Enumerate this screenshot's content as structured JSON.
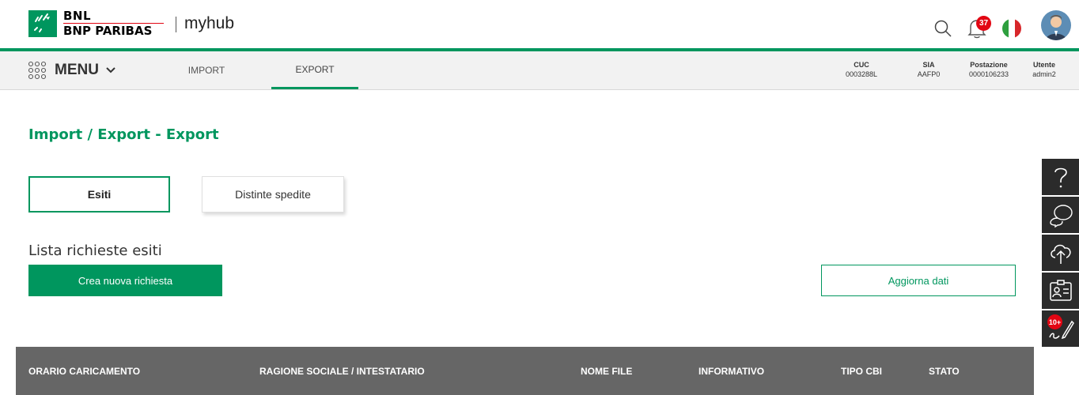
{
  "header": {
    "brand_line1": "BNL",
    "brand_line2": "BNP PARIBAS",
    "app_name": "myhub",
    "notifications_count": "37",
    "colors": {
      "accent": "#00965e",
      "brand_red": "#e20613",
      "table_header": "#666666",
      "side_tool": "#2b2b2b"
    }
  },
  "nav": {
    "menu_label": "MENU",
    "tabs": [
      {
        "label": "IMPORT",
        "active": false
      },
      {
        "label": "EXPORT",
        "active": true
      }
    ],
    "info": [
      {
        "key": "CUC",
        "value": "0003288L"
      },
      {
        "key": "SIA",
        "value": "AAFP0"
      },
      {
        "key": "Postazione",
        "value": "0000106233"
      },
      {
        "key": "Utente",
        "value": "admin2"
      }
    ]
  },
  "main": {
    "title": "Import / Export - Export",
    "tabs": [
      {
        "label": "Esiti",
        "selected": true
      },
      {
        "label": "Distinte spedite",
        "selected": false
      }
    ],
    "section_title": "Lista richieste esiti",
    "create_button": "Crea nuova richiesta",
    "refresh_button": "Aggiorna dati",
    "table": {
      "columns": [
        "ORARIO CARICAMENTO",
        "RAGIONE SOCIALE / INTESTATARIO",
        "NOME FILE",
        "INFORMATIVO",
        "TIPO CBI",
        "STATO"
      ],
      "rows": []
    }
  },
  "side_tools": {
    "items": [
      "help-icon",
      "chat-icon",
      "cloud-upload-icon",
      "contact-card-icon",
      "sign-document-icon"
    ],
    "sign_badge": "10+"
  }
}
